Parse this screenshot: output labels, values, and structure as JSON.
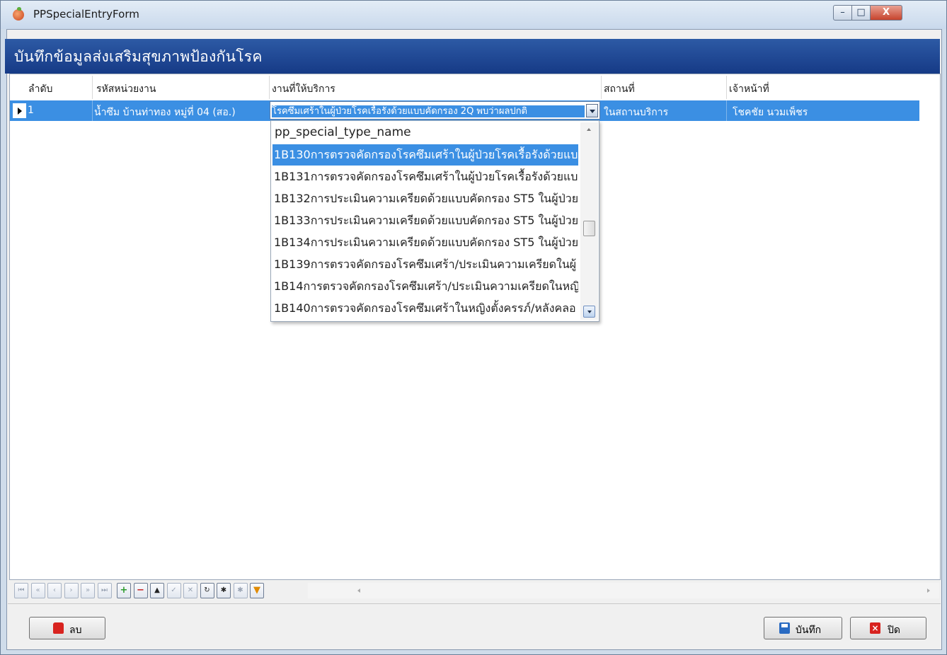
{
  "window": {
    "title": "PPSpecialEntryForm"
  },
  "header": {
    "title": "บันทึกข้อมูลส่งเสริมสุขภาพป้องกันโรค"
  },
  "grid": {
    "columns": [
      "ลำดับ",
      "รหัสหน่วยงาน",
      "งานที่ให้บริการ",
      "สถานที่",
      "เจ้าหน้าที่"
    ],
    "rows": [
      {
        "seq": "1",
        "unit": "น้ำซึม บ้านท่าทอง หมู่ที่ 04 (สอ.)",
        "service": "โรคซึมเศร้าในผู้ป่วยโรคเรื้อรังด้วยแบบคัดกรอง 2Q พบว่าผลปกติ",
        "place": "ในสถานบริการ",
        "staff": "โชคชัย นวมเพ็ชร"
      }
    ]
  },
  "dropdown": {
    "header": "pp_special_type_name",
    "selected_index": 0,
    "items": [
      "1B130การตรวจคัดกรองโรคซึมเศร้าในผู้ป่วยโรคเรื้อรังด้วยแบบ",
      "1B131การตรวจคัดกรองโรคซึมเศร้าในผู้ป่วยโรคเรื้อรังด้วยแบบ",
      "1B132การประเมินความเครียดด้วยแบบคัดกรอง ST5 ในผู้ป่วย",
      "1B133การประเมินความเครียดด้วยแบบคัดกรอง ST5 ในผู้ป่วย",
      "1B134การประเมินความเครียดด้วยแบบคัดกรอง ST5 ในผู้ป่วย",
      "1B139การตรวจคัดกรองโรคซึมเศร้า/ประเมินความเครียดในผู้",
      "1B14การตรวจคัดกรองโรคซึมเศร้า/ประเมินความเครียดในหญิ",
      "1B140การตรวจคัดกรองโรคซึมเศร้าในหญิงตั้งครรภ์/หลังคลอ"
    ]
  },
  "navigator": {
    "buttons": [
      {
        "name": "first-icon",
        "glyph": "⏮",
        "enabled": false
      },
      {
        "name": "prev-page-icon",
        "glyph": "«",
        "enabled": false
      },
      {
        "name": "prev-icon",
        "glyph": "‹",
        "enabled": false
      },
      {
        "name": "next-icon",
        "glyph": "›",
        "enabled": false
      },
      {
        "name": "next-page-icon",
        "glyph": "»",
        "enabled": false
      },
      {
        "name": "last-icon",
        "glyph": "⏭",
        "enabled": false
      },
      {
        "name": "add-record-icon",
        "glyph": "+",
        "enabled": true,
        "color": "#2a9a2a"
      },
      {
        "name": "delete-record-icon",
        "glyph": "−",
        "enabled": true,
        "color": "#c62020"
      },
      {
        "name": "edit-record-icon",
        "glyph": "▲",
        "enabled": true
      },
      {
        "name": "post-edit-icon",
        "glyph": "✓",
        "enabled": false
      },
      {
        "name": "cancel-edit-icon",
        "glyph": "✕",
        "enabled": false
      },
      {
        "name": "refresh-icon",
        "glyph": "↻",
        "enabled": true
      },
      {
        "name": "bookmark-icon",
        "glyph": "✱",
        "enabled": true
      },
      {
        "name": "goto-bookmark-icon",
        "glyph": "✱",
        "enabled": false
      },
      {
        "name": "filter-icon",
        "glyph": "▼",
        "enabled": true,
        "color": "#e08a00"
      }
    ]
  },
  "buttons": {
    "delete": "ลบ",
    "save": "บันทึก",
    "close": "ปิด",
    "close_icon_glyph": "×"
  },
  "window_controls": {
    "minimize": "–",
    "maximize": "□",
    "close": "X"
  },
  "colors": {
    "selection": "#3b8fe3",
    "header_band": "#1f4797"
  }
}
